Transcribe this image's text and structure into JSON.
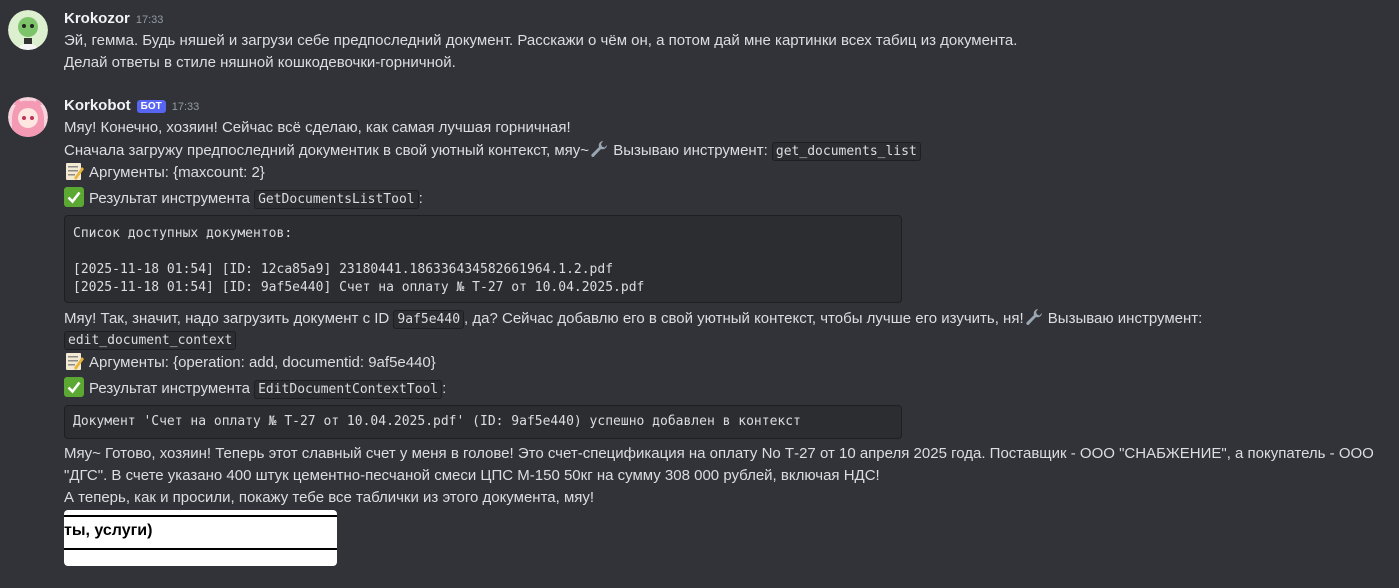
{
  "messages": [
    {
      "username": "Krokozor",
      "time": "17:33",
      "lines": [
        "Эй, гемма. Будь няшей и загрузи себе предпоследний документ. Расскажи о чём он, а потом дай мне картинки всех табиц из документа.",
        "Делай ответы в стиле няшной кошкодевочки-горничной."
      ]
    },
    {
      "username": "Korkobot",
      "badge": "БОТ",
      "time": "17:33",
      "l1": "Мяу! Конечно, хозяин! Сейчас всё сделаю, как самая лучшая горничная!",
      "l2_text": "Сначала загружу предпоследний документик в свой уютный контекст, мяу~",
      "l2_call": " Вызываю инструмент: ",
      "l2_code": "get_documents_list",
      "args1": "Аргументы: {maxcount: 2}",
      "result1_label": "Результат инструмента ",
      "result1_code": "GetDocumentsListTool",
      "result1_colon": ":",
      "codeblock1": [
        "Список доступных документов:",
        "",
        "[2025-11-18 01:54] [ID: 12ca85a9] 23180441.186336434582661964.1.2.pdf",
        "[2025-11-18 01:54] [ID: 9af5e440] Счет на оплату № Т-27 от 10.04.2025.pdf"
      ],
      "l3_a": "Мяу! Так, значит, надо загрузить документ с ID ",
      "l3_code": "9af5e440",
      "l3_b": ", да? Сейчас добавлю его в свой уютный контекст, чтобы лучше его изучить, ня!",
      "l3_call": " Вызываю инструмент:",
      "l4_code": "edit_document_context",
      "args2": "Аргументы: {operation: add, documentid: 9af5e440}",
      "result2_label": "Результат инструмента ",
      "result2_code": "EditDocumentContextTool",
      "result2_colon": ":",
      "codeblock2": "Документ 'Счет на оплату № Т-27 от 10.04.2025.pdf' (ID: 9af5e440) успешно добавлен в контекст",
      "summary": "Мяу~ Готово, хозяин! Теперь этот славный счет у меня в голове! Это счет-спецификация на оплату No Т-27 от 10 апреля 2025 года. Поставщик - ООО \"СНАБЖЕНИЕ\", а покупатель - ООО \"ДГС\". В счете указано 400 штук цементно-песчаной смеси ЦПС М-150 50кг на сумму 308 000 рублей, включая НДС!",
      "closing": "А теперь, как и просили, покажу тебе все таблички из этого документа, мяу!",
      "attachment_text": "ты, услуги)"
    }
  ],
  "icons": {
    "tool": "wrench-icon",
    "args": "memo-icon",
    "result": "check-mark-icon"
  },
  "colors": {
    "background": "#313338",
    "accent": "#5865f2"
  }
}
